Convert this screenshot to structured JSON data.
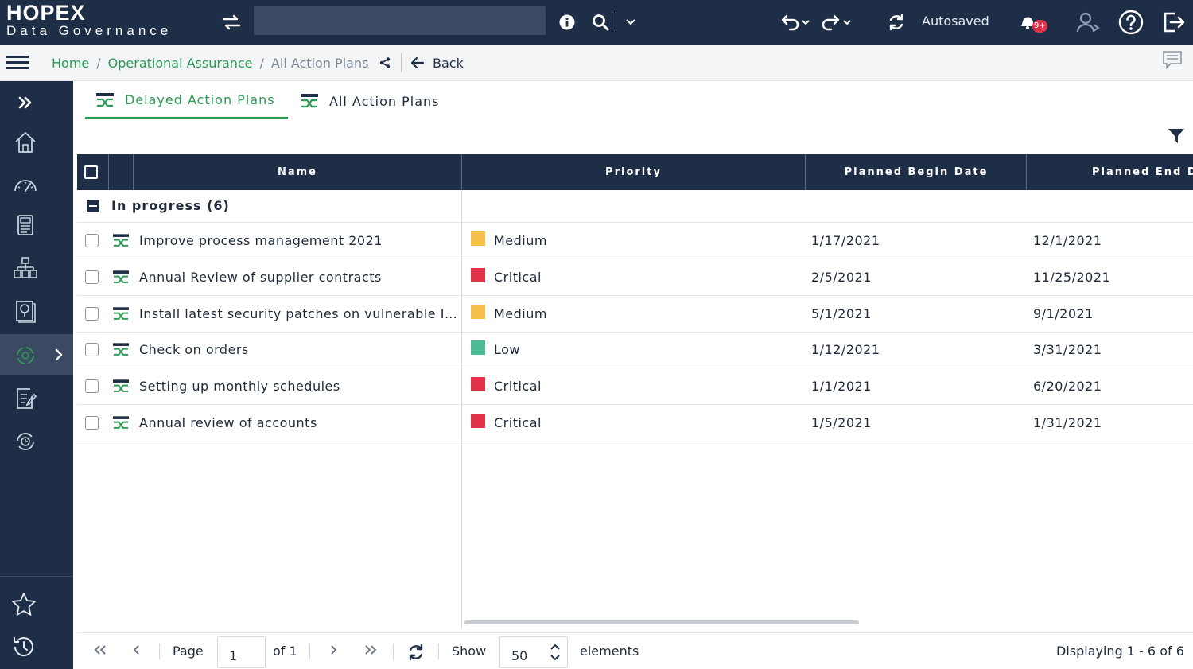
{
  "app": {
    "logo_main": "HOPEX",
    "logo_sub": "Data Governance",
    "status": "Autosaved",
    "notification_badge": "9+"
  },
  "breadcrumb": {
    "home": "Home",
    "parent": "Operational Assurance",
    "current": "All Action Plans",
    "back_label": "Back",
    "separator": "/"
  },
  "tabs": [
    {
      "label": "Delayed Action Plans",
      "active": true
    },
    {
      "label": "All Action Plans",
      "active": false
    }
  ],
  "grid": {
    "columns": [
      "Name",
      "Priority",
      "Planned Begin Date",
      "Planned End D"
    ],
    "group_label": "In progress (6)",
    "rows": [
      {
        "name": "Improve process management 2021",
        "priority": "Medium",
        "begin": "1/17/2021",
        "end": "12/1/2021"
      },
      {
        "name": "Annual Review of supplier contracts",
        "priority": "Critical",
        "begin": "2/5/2021",
        "end": "11/25/2021"
      },
      {
        "name": "Install latest security patches on vulnerable IT...",
        "priority": "Medium",
        "begin": "5/1/2021",
        "end": "9/1/2021"
      },
      {
        "name": "Check on orders",
        "priority": "Low",
        "begin": "1/12/2021",
        "end": "3/31/2021"
      },
      {
        "name": "Setting up monthly schedules",
        "priority": "Critical",
        "begin": "1/1/2021",
        "end": "6/20/2021"
      },
      {
        "name": "Annual review of accounts",
        "priority": "Critical",
        "begin": "1/5/2021",
        "end": "1/31/2021"
      }
    ]
  },
  "priority_colors": {
    "Medium": "#f5c04a",
    "Critical": "#e0334a",
    "Low": "#4dbb98"
  },
  "pager": {
    "page_label": "Page",
    "page_value": "1",
    "of_label": "of 1",
    "show_label": "Show",
    "show_value": "50",
    "elements_label": "elements",
    "displaying": "Displaying 1 - 6 of 6"
  },
  "colors": {
    "navy": "#1f2e47",
    "accent_green": "#2b9a55",
    "search_bg": "#3a4a62"
  },
  "icons": {
    "sidebar": [
      "expand-icon",
      "home-icon",
      "dashboard-icon",
      "glossary-icon",
      "organization-icon",
      "library-icon",
      "assurance-icon",
      "edit-report-icon",
      "risk-cycle-icon",
      "favorites-icon",
      "history-icon"
    ]
  }
}
